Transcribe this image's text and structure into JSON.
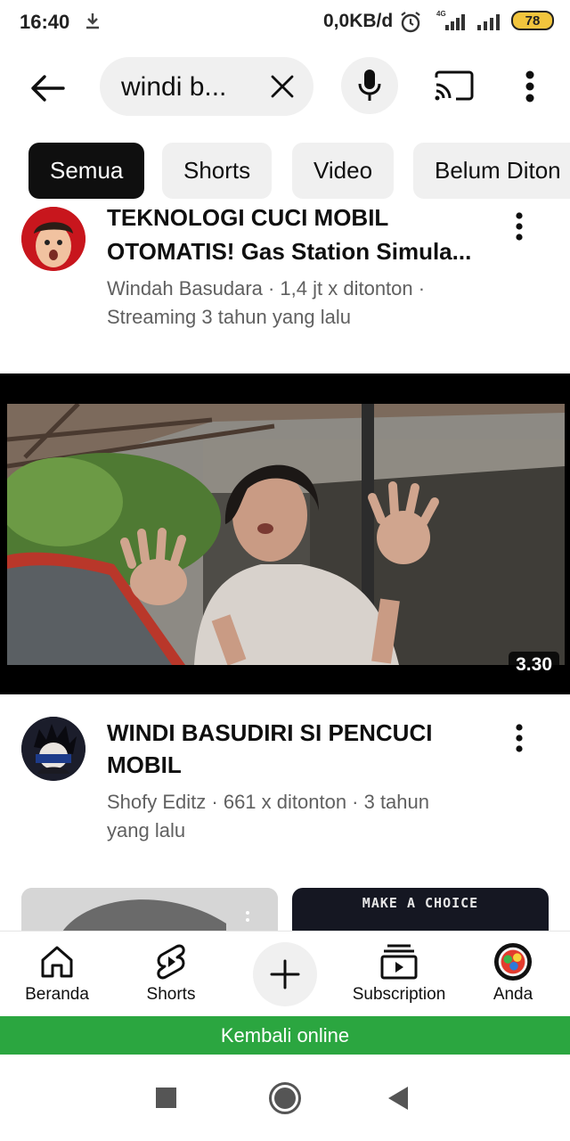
{
  "status_bar": {
    "time": "16:40",
    "data_speed": "0,0KB/d",
    "network_label": "4G",
    "battery": "78"
  },
  "search": {
    "query": "windi b...",
    "icons": [
      "back-arrow-icon",
      "clear-icon",
      "mic-icon",
      "cast-icon",
      "more-vert-icon"
    ]
  },
  "chips": [
    "Semua",
    "Shorts",
    "Video",
    "Belum Diton"
  ],
  "results": [
    {
      "title_line1": "TEKNOLOGI CUCI MOBIL",
      "title_line2": "OTOMATIS! Gas Station Simula...",
      "meta_line1": "Windah Basudara · 1,4 jt x ditonton ·",
      "meta_line2": "Streaming 3 tahun yang lalu"
    },
    {
      "duration": "3.30",
      "title_line1": "WINDI BASUDIRI SI PENCUCI",
      "title_line2": "MOBIL",
      "meta_line1": "Shofy Editz · 661 x ditonton · 3 tahun",
      "meta_line2": "yang lalu"
    }
  ],
  "shorts_preview": {
    "second_text": "MAKE A CHOICE"
  },
  "bottom_nav": {
    "items": [
      {
        "label": "Beranda",
        "icon": "home-icon"
      },
      {
        "label": "Shorts",
        "icon": "shorts-icon"
      },
      {
        "label": "",
        "icon": "plus-icon"
      },
      {
        "label": "Subscription",
        "icon": "subscriptions-icon"
      },
      {
        "label": "Anda",
        "icon": "avatar"
      }
    ]
  },
  "banner": {
    "text": "Kembali online",
    "color": "#2ba640"
  },
  "colors": {
    "chip_active_bg": "#0f0f0f",
    "chip_bg": "#f0f0f0",
    "meta_text": "#606060"
  }
}
